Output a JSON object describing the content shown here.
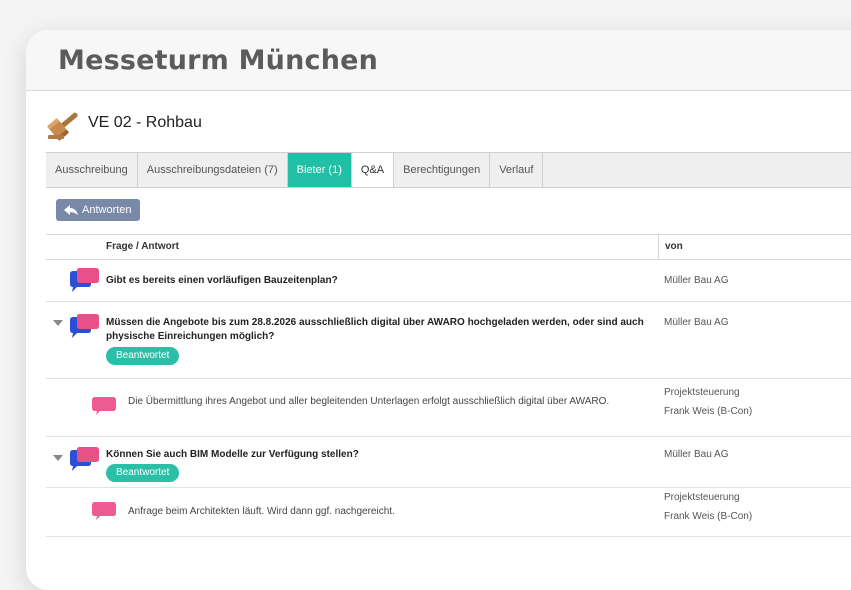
{
  "window": {
    "title": "Messeturm München"
  },
  "project": {
    "title": "VE 02 - Rohbau",
    "icon": "gavel-icon"
  },
  "tabs": [
    {
      "label": "Ausschreibung"
    },
    {
      "label": "Ausschreibungsdateien (7)"
    },
    {
      "label": "Bieter (1)"
    },
    {
      "label": "Q&A"
    },
    {
      "label": "Berechtigungen"
    },
    {
      "label": "Verlauf"
    }
  ],
  "toolbar": {
    "reply_label": "Antworten",
    "reply_icon": "reply-arrow-icon"
  },
  "table": {
    "headers": {
      "question": "Frage / Antwort",
      "from": "von"
    },
    "rows": [
      {
        "question": "Gibt es bereits einen vorläufigen Bauzeitenplan?",
        "from": "Müller Bau AG"
      },
      {
        "question": "Müssen die Angebote bis zum 28.8.2026 ausschließlich digital über AWARO hochgeladen werden, oder sind auch physische Einreichungen möglich?",
        "from": "Müller Bau AG",
        "badge": "Beantwortet"
      },
      {
        "answer": "Die Übermittlung ihres Angebot und aller begleitenden Unterlagen erfolgt ausschließlich digital über AWARO.",
        "from_role": "Projektsteuerung",
        "from_name": "Frank Weis (B-Con)"
      },
      {
        "question": "Können Sie auch BIM Modelle zur Verfügung stellen?",
        "from": "Müller Bau AG",
        "badge": "Beantwortet"
      },
      {
        "answer": "Anfrage beim Architekten läuft. Wird dann ggf. nachgereicht.",
        "from_role": "Projektsteuerung",
        "from_name": "Frank Weis (B-Con)"
      }
    ]
  },
  "colors": {
    "accent": "#20bfa6",
    "badge": "#2bbfa7",
    "question_bubble_front": "#e8508a",
    "question_bubble_back": "#2c4fd6",
    "answer_bubble": "#ee5a92",
    "reply_button": "#7a89a8"
  }
}
